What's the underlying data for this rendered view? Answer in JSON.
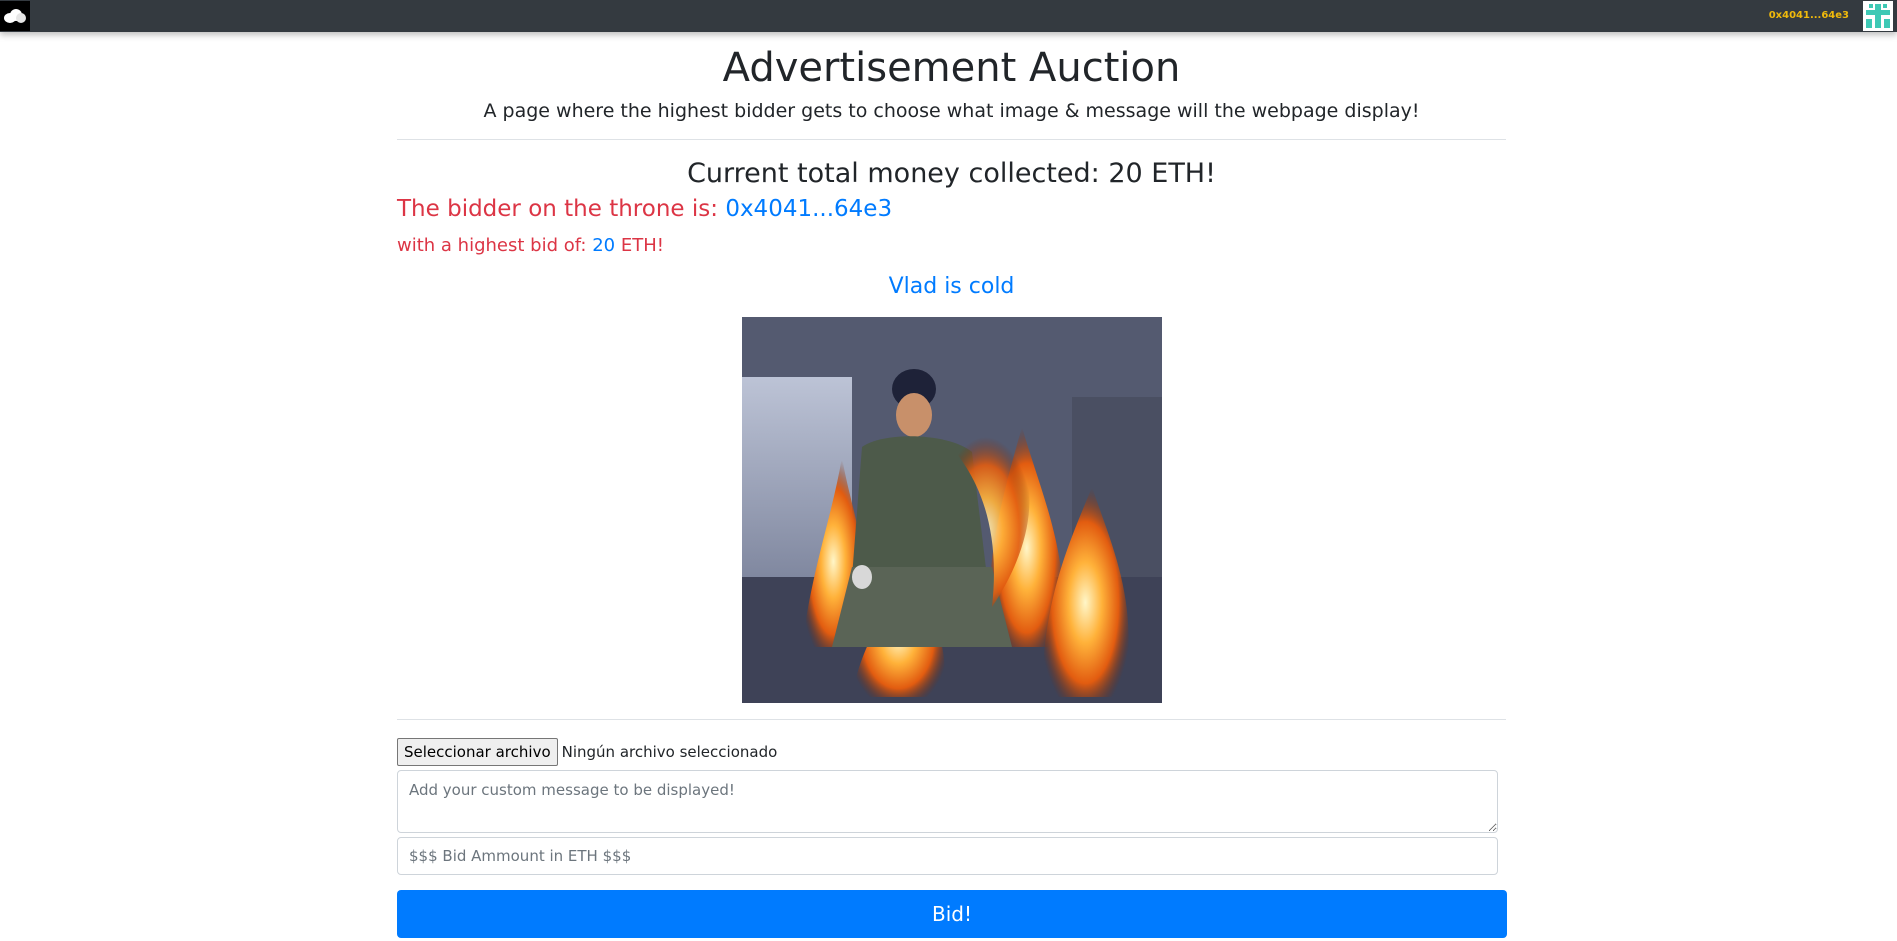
{
  "navbar": {
    "account": "0x4041...64e3",
    "logo_icon": "cloud-logo-icon",
    "avatar_icon": "identicon-avatar"
  },
  "page": {
    "title": "Advertisement Auction",
    "subtitle": "A page where the highest bidder gets to choose what image & message will the webpage display!"
  },
  "auction": {
    "total_label": "Current total money collected: 20 ETH!",
    "throne_label": "The bidder on the throne is:",
    "throne_address": "0x4041...64e3",
    "bid_prefix": "with a highest bid of:",
    "bid_value": "20",
    "bid_suffix": "ETH!",
    "ad_message": "Vlad is cold"
  },
  "form": {
    "file_button": "Seleccionar archivo",
    "file_status": "Ningún archivo seleccionado",
    "message_placeholder": "Add your custom message to be displayed!",
    "bid_placeholder": "$$$ Bid Ammount in ETH $$$",
    "submit_label": "Bid!"
  },
  "colors": {
    "navbar": "#343a40",
    "danger": "#dc3545",
    "primary": "#007bff",
    "account": "#f0b90b"
  }
}
